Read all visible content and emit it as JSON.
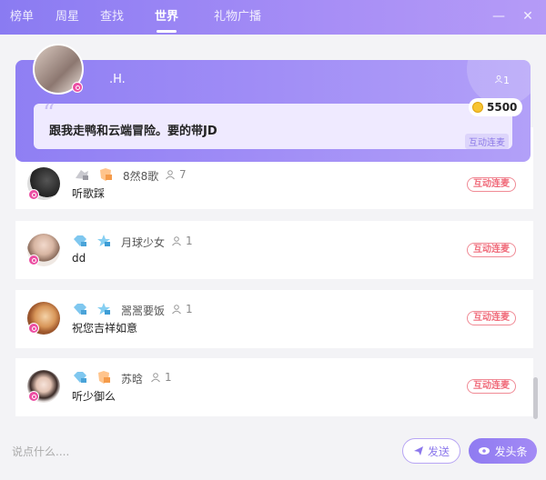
{
  "tabs": [
    {
      "label": "榜单"
    },
    {
      "label": "周星"
    },
    {
      "label": "查找"
    },
    {
      "label": "世界"
    },
    {
      "label": "礼物广播"
    }
  ],
  "window": {
    "minimize": "—",
    "close": "✕"
  },
  "featured": {
    "name": ".H.",
    "online_count": "1",
    "message": "跟我走鸭和云端冒险。要的带JD",
    "coins": "5500",
    "tag": "互动连麦"
  },
  "messages": [
    {
      "name": "8然8歌",
      "count": "7",
      "text": "听歌踩",
      "tag": "互动连麦"
    },
    {
      "name": "月球少女",
      "count": "1",
      "text": "dd",
      "tag": "互动连麦"
    },
    {
      "name": "翯翯要饭",
      "count": "1",
      "text": "祝您吉祥如意",
      "tag": "互动连麦"
    },
    {
      "name": "苏晗",
      "count": "1",
      "text": "听少御么",
      "tag": "互动连麦"
    }
  ],
  "footer": {
    "placeholder": "说点什么....",
    "send_label": "发送",
    "headline_label": "发头条"
  },
  "colors": {
    "accent": "#8f7bf1",
    "tag": "#f06b7a",
    "badge": "#ec4fa3"
  }
}
